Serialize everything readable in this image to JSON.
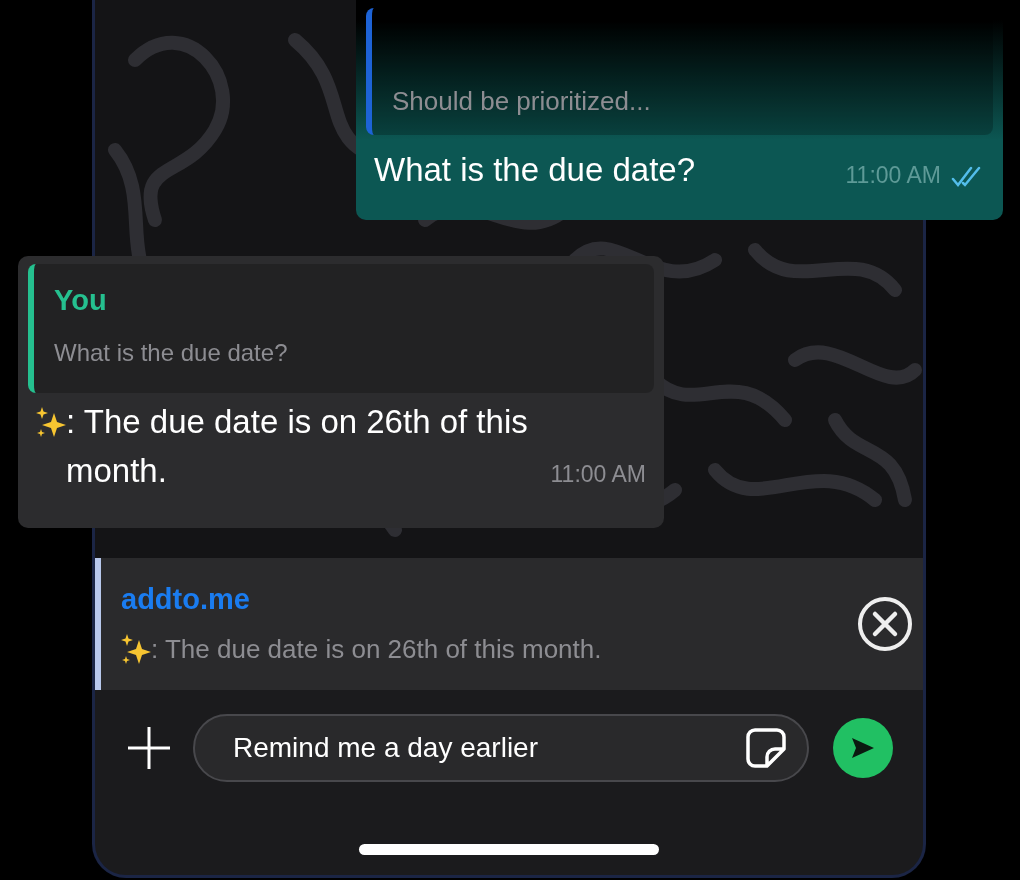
{
  "outgoing_message": {
    "quote": {
      "text": "Should be prioritized..."
    },
    "text": "What is the due date?",
    "time": "11:00 AM",
    "read": true
  },
  "incoming_message": {
    "quote": {
      "author": "You",
      "text": "What is the due date?"
    },
    "text": ": The due date is on 26th of this month.",
    "time": "11:00 AM"
  },
  "reply_preview": {
    "title": "addto.me",
    "text": ": The due date is on 26th of this month."
  },
  "composer": {
    "value": "Remind me a day earlier"
  }
}
